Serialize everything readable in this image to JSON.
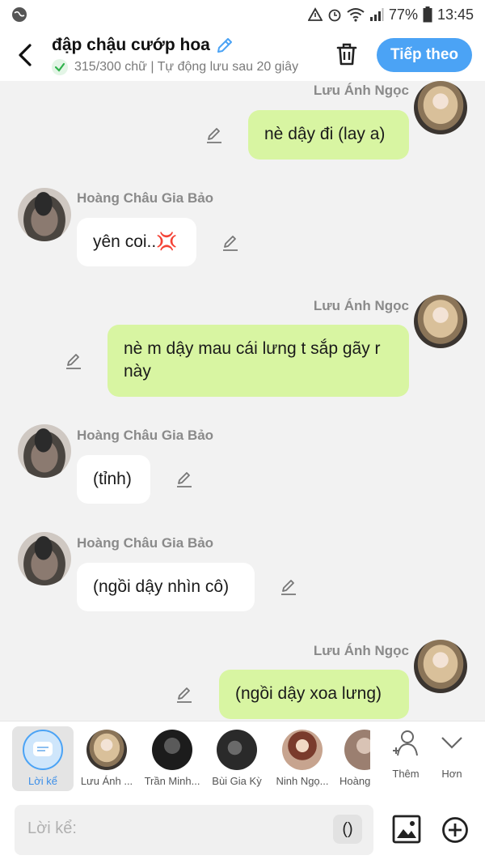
{
  "status": {
    "battery": "77%",
    "time": "13:45"
  },
  "header": {
    "title": "đập chậu cướp hoa",
    "subtitle": "315/300 chữ | Tự động lưu sau 20 giây",
    "next_label": "Tiếp theo"
  },
  "messages": [
    {
      "side": "right",
      "name": "Lưu Ánh Ngọc",
      "text": "nè dậy đi (lay a)"
    },
    {
      "side": "left",
      "name": "Hoàng Châu Gia Bảo",
      "text": "yên coi..💢"
    },
    {
      "side": "right",
      "name": "Lưu Ánh Ngọc",
      "text": "nè m dậy mau cái lưng t sắp gãy r này"
    },
    {
      "side": "left",
      "name": "Hoàng Châu Gia Bảo",
      "text": "(tỉnh)"
    },
    {
      "side": "left",
      "name": "Hoàng Châu Gia Bảo",
      "text": "(ngồi dậy nhìn cô)"
    },
    {
      "side": "right",
      "name": "Lưu Ánh Ngọc",
      "text": "(ngồi dậy xoa lưng)"
    }
  ],
  "characters": [
    {
      "label": "Lời kể"
    },
    {
      "label": "Lưu Ánh ..."
    },
    {
      "label": "Trần Minh..."
    },
    {
      "label": "Bùi Gia Kỳ"
    },
    {
      "label": "Ninh Ngọ..."
    },
    {
      "label": "Hoàng"
    }
  ],
  "tools": {
    "add_label": "Thêm",
    "more_label": "Hơn"
  },
  "input": {
    "placeholder": "Lời kể:",
    "paren": "()"
  }
}
